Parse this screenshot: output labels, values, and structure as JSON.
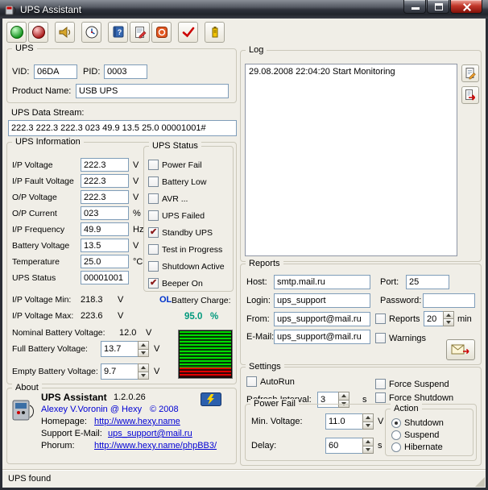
{
  "window": {
    "title": "UPS Assistant",
    "status": "UPS found"
  },
  "colors": {
    "link": "#0000d4",
    "ol_indicator": "#0033cc",
    "battery_charge_text": "#00997d",
    "checkmark": "#8b1a1a",
    "input_border": "#7f9db9"
  },
  "toolbar": {
    "buttons": [
      {
        "icon": "connect-icon"
      },
      {
        "icon": "disconnect-icon"
      },
      {
        "icon": "sound-icon"
      },
      {
        "icon": "schedule-icon"
      },
      {
        "icon": "help-icon"
      },
      {
        "icon": "report-icon"
      },
      {
        "icon": "stop-icon"
      },
      {
        "icon": "test-icon"
      },
      {
        "icon": "battery-icon"
      }
    ]
  },
  "ups": {
    "group_label": "UPS",
    "vid_label": "VID:",
    "vid": "06DA",
    "pid_label": "PID:",
    "pid": "0003",
    "product_label": "Product Name:",
    "product": "USB UPS"
  },
  "stream": {
    "label": "UPS Data Stream:",
    "value": "222.3 222.3 222.3 023 49.9 13.5 25.0 00001001#"
  },
  "info": {
    "group_label": "UPS Information",
    "rows": [
      {
        "label": "I/P Voltage",
        "value": "222.3",
        "unit": "V"
      },
      {
        "label": "I/P Fault Voltage",
        "value": "222.3",
        "unit": "V"
      },
      {
        "label": "O/P Voltage",
        "value": "222.3",
        "unit": "V"
      },
      {
        "label": "O/P Current",
        "value": "023",
        "unit": "%"
      },
      {
        "label": "I/P Frequency",
        "value": "49.9",
        "unit": "Hz"
      },
      {
        "label": "Battery Voltage",
        "value": "13.5",
        "unit": "V"
      },
      {
        "label": "Temperature",
        "value": "25.0",
        "unit": "°C"
      },
      {
        "label": "UPS Status",
        "value": "00001001",
        "unit": ""
      }
    ],
    "min": {
      "label": "I/P Voltage Min:",
      "value": "218.3",
      "unit": "V"
    },
    "max": {
      "label": "I/P Voltage Max:",
      "value": "223.6",
      "unit": "V"
    },
    "ol": "OL",
    "charge_label": "Battery Charge:",
    "charge_value": "95.0",
    "charge_unit": "%",
    "nominal": {
      "label": "Nominal Battery Voltage:",
      "value": "12.0",
      "unit": "V"
    },
    "full": {
      "label": "Full Battery Voltage:",
      "value": "13.7",
      "unit": "V"
    },
    "empty": {
      "label": "Empty Battery Voltage:",
      "value": "9.7",
      "unit": "V"
    }
  },
  "status_flags": {
    "group_label": "UPS Status",
    "items": [
      {
        "label": "Power Fail",
        "checked": false
      },
      {
        "label": "Battery Low",
        "checked": false
      },
      {
        "label": "AVR ...",
        "checked": false
      },
      {
        "label": "UPS Failed",
        "checked": false
      },
      {
        "label": "Standby UPS",
        "checked": true
      },
      {
        "label": "Test in Progress",
        "checked": false
      },
      {
        "label": "Shutdown Active",
        "checked": false
      },
      {
        "label": "Beeper On",
        "checked": true
      }
    ]
  },
  "log": {
    "group_label": "Log",
    "entries": [
      "29.08.2008 22:04:20 Start Monitoring"
    ]
  },
  "reports": {
    "group_label": "Reports",
    "host_label": "Host:",
    "host": "smtp.mail.ru",
    "port_label": "Port:",
    "port": "25",
    "login_label": "Login:",
    "login": "ups_support",
    "password_label": "Password:",
    "password": "",
    "from_label": "From:",
    "from": "ups_support@mail.ru",
    "email_label": "E-Mail:",
    "email": "ups_support@mail.ru",
    "reports_check": {
      "label": "Reports",
      "checked": false
    },
    "interval": "20",
    "interval_unit": "min",
    "warnings_check": {
      "label": "Warnings",
      "checked": false
    }
  },
  "settings": {
    "group_label": "Settings",
    "autorun": {
      "label": "AutoRun",
      "checked": false
    },
    "refresh_label": "Refresh Interval:",
    "refresh": "3",
    "refresh_unit": "s",
    "force_suspend": {
      "label": "Force Suspend",
      "checked": false
    },
    "force_shutdown": {
      "label": "Force Shutdown",
      "checked": false
    },
    "power_fail": {
      "group_label": "Power Fail",
      "min_label": "Min. Voltage:",
      "min": "11.0",
      "min_unit": "V",
      "delay_label": "Delay:",
      "delay": "60",
      "delay_unit": "s",
      "action": {
        "group_label": "Action",
        "options": [
          {
            "label": "Shutdown",
            "selected": true
          },
          {
            "label": "Suspend",
            "selected": false
          },
          {
            "label": "Hibernate",
            "selected": false
          }
        ]
      }
    }
  },
  "about": {
    "group_label": "About",
    "name": "UPS Assistant",
    "version": "1.2.0.26",
    "author": "Alexey V.Voronin @ Hexy",
    "copyright": "© 2008",
    "homepage_label": "Homepage:",
    "homepage": "http://www.hexy.name",
    "support_label": "Support E-Mail:",
    "support": "ups_support@mail.ru",
    "phorum_label": "Phorum:",
    "phorum": "http://www.hexy.name/phpBB3/"
  }
}
